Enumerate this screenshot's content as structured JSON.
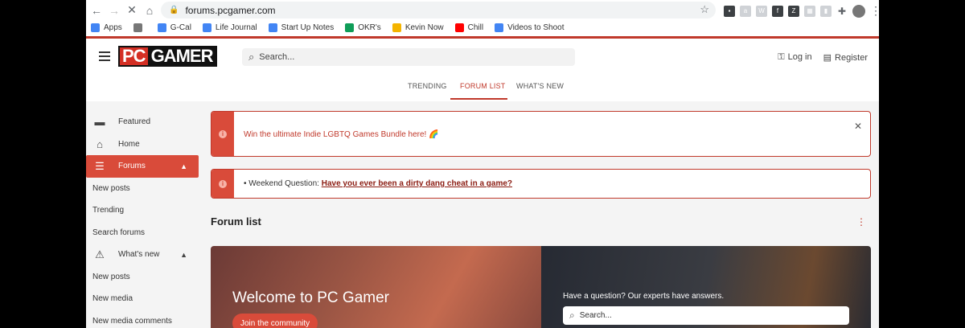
{
  "browser": {
    "url": "forums.pcgamer.com",
    "bookmarks": [
      {
        "label": "Apps",
        "color": "#4285f4"
      },
      {
        "label": "",
        "color": "#777777"
      },
      {
        "label": "G-Cal",
        "color": "#4285f4"
      },
      {
        "label": "Life Journal",
        "color": "#4285f4"
      },
      {
        "label": "Start Up Notes",
        "color": "#4285f4"
      },
      {
        "label": "OKR's",
        "color": "#0f9d58"
      },
      {
        "label": "Kevin Now",
        "color": "#f4b400"
      },
      {
        "label": "Chill",
        "color": "#ff0000"
      },
      {
        "label": "Videos to Shoot",
        "color": "#4285f4"
      }
    ]
  },
  "header": {
    "logo_pc": "PC",
    "logo_gamer": "GAMER",
    "search_placeholder": "Search...",
    "login": "Log in",
    "register": "Register"
  },
  "tabs": [
    {
      "label": "TRENDING",
      "active": false
    },
    {
      "label": "FORUM LIST",
      "active": true
    },
    {
      "label": "WHAT'S NEW",
      "active": false
    }
  ],
  "sidebar": {
    "featured": "Featured",
    "home": "Home",
    "forums": "Forums",
    "forums_sub": [
      "New posts",
      "Trending",
      "Search forums"
    ],
    "whats_new": "What's new",
    "whats_new_sub": [
      "New posts",
      "New media",
      "New media comments"
    ]
  },
  "notices": {
    "first": "Win the ultimate Indie LGBTQ Games Bundle here! 🌈",
    "second_prefix": "• Weekend Question: ",
    "second_link": "Have you ever been a dirty dang cheat in a game?"
  },
  "main": {
    "title": "Forum list"
  },
  "hero": {
    "welcome": "Welcome to PC Gamer",
    "join": "Join the community",
    "question": "Have a question? Our experts have answers.",
    "search_placeholder": "Search..."
  },
  "colors": {
    "accent": "#d94b3a",
    "brand_red": "#d42f24"
  }
}
